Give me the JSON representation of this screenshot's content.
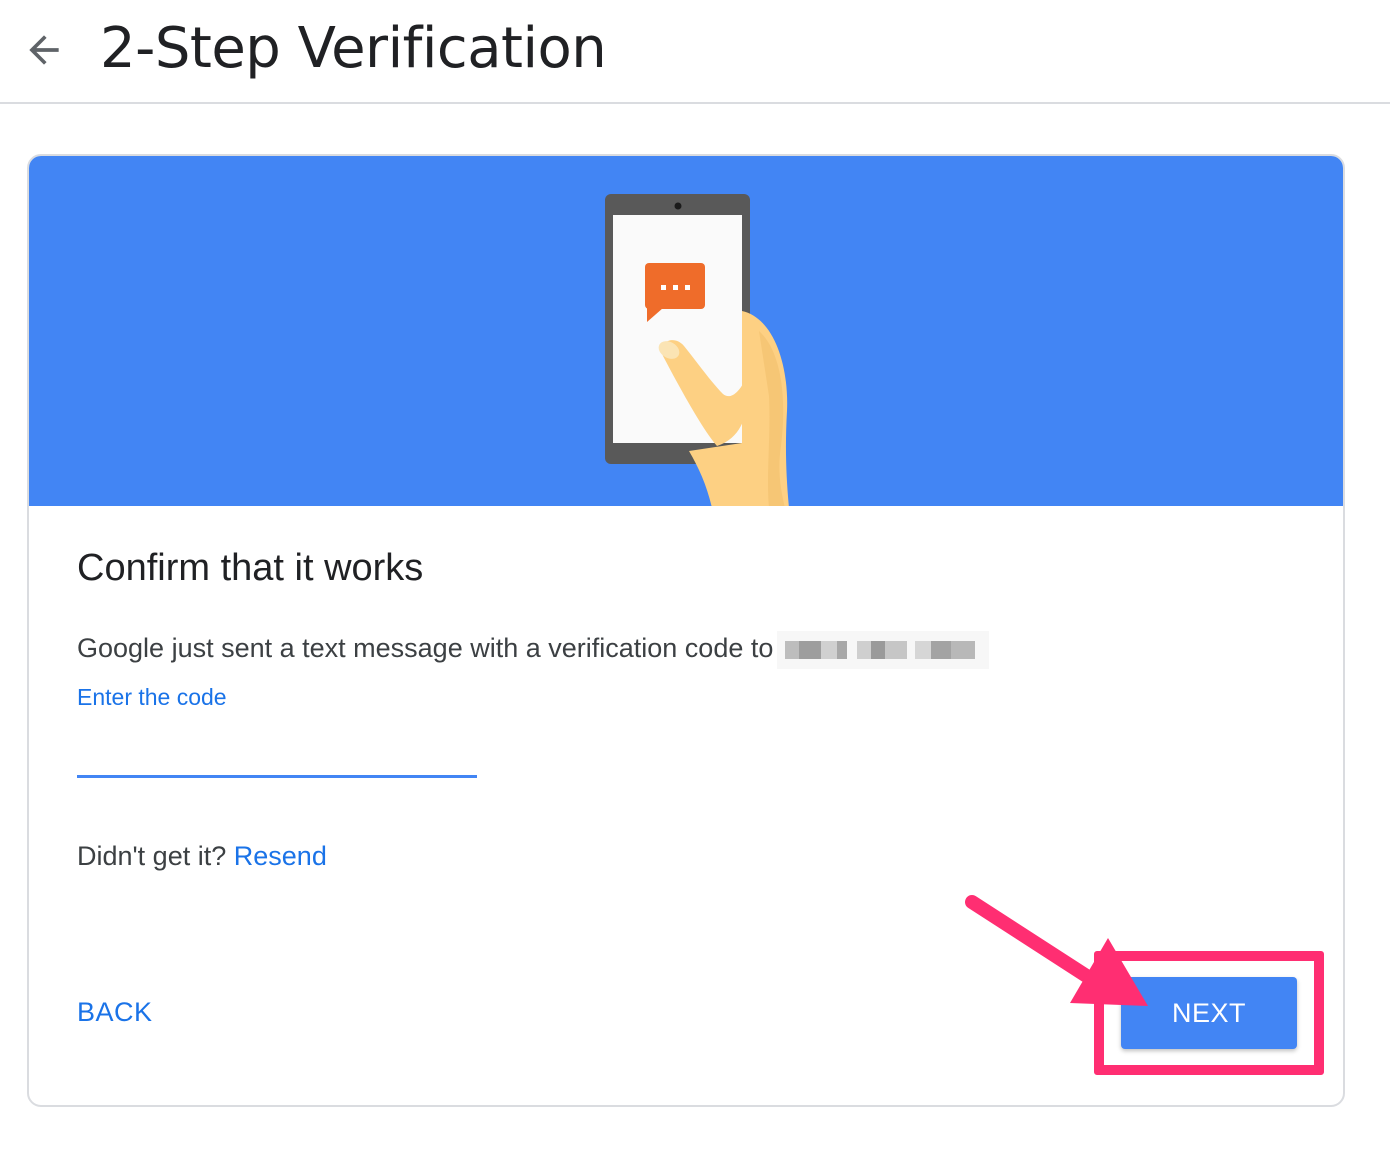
{
  "header": {
    "back_icon": "arrow-back-icon",
    "title": "2-Step Verification"
  },
  "card": {
    "illustration": "phone-with-message-illustration",
    "heading": "Confirm that it works",
    "description": "Google just sent a text message with a verification code to",
    "phone_number_redacted": true,
    "field_label": "Enter the code",
    "code_value": "",
    "resend_prompt": "Didn't get it?",
    "resend_link": "Resend",
    "back_label": "BACK",
    "next_label": "NEXT"
  },
  "annotation": {
    "highlight_color": "#ff2e72",
    "arrow_color": "#ff2e72",
    "target": "next-button"
  },
  "colors": {
    "accent": "#4285f4",
    "link": "#1a73e8",
    "message_bubble": "#ef6c2a",
    "hand": "#fdd083"
  }
}
